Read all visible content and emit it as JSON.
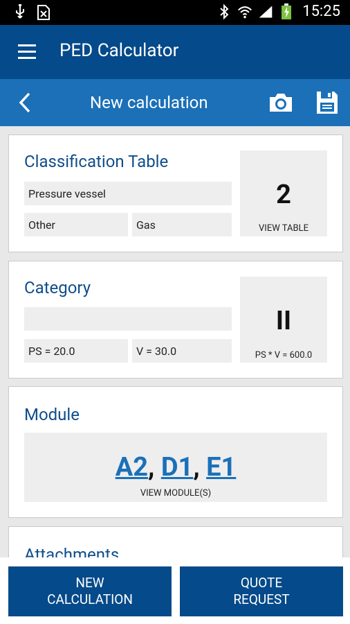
{
  "status_bar": {
    "time": "15:25"
  },
  "app_bar": {
    "title": "PED Calculator"
  },
  "sub_bar": {
    "title": "New calculation"
  },
  "classification": {
    "title": "Classification Table",
    "equipment": "Pressure vessel",
    "fluid_group": "Other",
    "fluid_state": "Gas",
    "table_number": "2",
    "view_table_label": "VIEW TABLE"
  },
  "category": {
    "title": "Category",
    "empty_field": "",
    "ps": "PS = 20.0",
    "v": "V = 30.0",
    "value": "II",
    "product_label": "PS * V = 600.0"
  },
  "module": {
    "title": "Module",
    "modules": [
      "A2",
      "D1",
      "E1"
    ],
    "separator": ", ",
    "view_label": "VIEW MODULE(S)"
  },
  "attachments": {
    "title": "Attachments"
  },
  "buttons": {
    "new_calc_line1": "NEW",
    "new_calc_line2": "CALCULATION",
    "quote_line1": "QUOTE",
    "quote_line2": "REQUEST"
  },
  "colors": {
    "app_bar": "#054a8a",
    "sub_bar": "#1b70b8",
    "title_text": "#104d8b",
    "link": "#1b70b8"
  }
}
